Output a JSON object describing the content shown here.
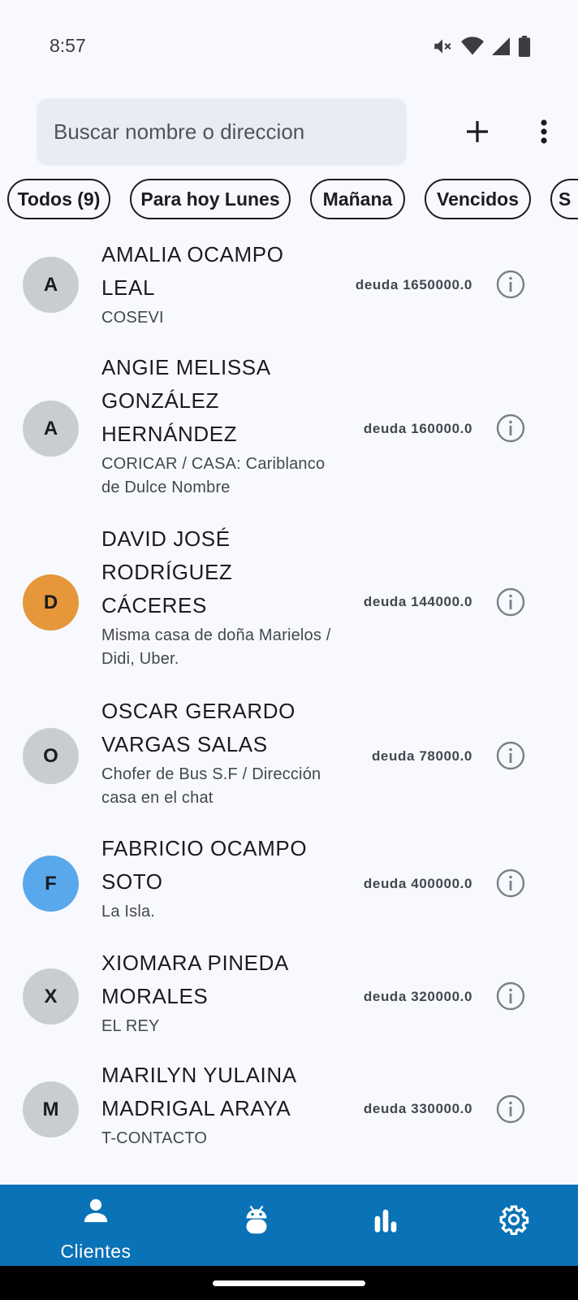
{
  "status_bar": {
    "time": "8:57"
  },
  "search": {
    "placeholder": "Buscar nombre o direccion"
  },
  "chips": [
    {
      "label": "Todos (9)"
    },
    {
      "label": "Para hoy Lunes"
    },
    {
      "label": "Mañana"
    },
    {
      "label": "Vencidos"
    },
    {
      "label": "S"
    }
  ],
  "clients": [
    {
      "initial": "A",
      "avatar_color": "#c9ccd1",
      "name": "AMALIA OCAMPO LEAL",
      "address": "COSEVI",
      "debt": "deuda 1650000.0"
    },
    {
      "initial": "A",
      "avatar_color": "#c9ccd1",
      "name": "ANGIE MELISSA GONZÁLEZ HERNÁNDEZ",
      "address": "CORICAR / CASA: Cariblanco de Dulce Nombre",
      "debt": "deuda 160000.0"
    },
    {
      "initial": "D",
      "avatar_color": "#e5973a",
      "name": "DAVID JOSÉ RODRÍGUEZ CÁCERES",
      "address": "Misma casa de doña Marielos / Didi, Uber.",
      "debt": "deuda 144000.0"
    },
    {
      "initial": "O",
      "avatar_color": "#c9ccd1",
      "name": "OSCAR GERARDO VARGAS SALAS",
      "address": "Chofer de Bus S.F / Dirección casa en el chat",
      "debt": "deuda 78000.0"
    },
    {
      "initial": "F",
      "avatar_color": "#5aa8ec",
      "name": "FABRICIO OCAMPO SOTO",
      "address": "La Isla.",
      "debt": "deuda 400000.0"
    },
    {
      "initial": "X",
      "avatar_color": "#c9ccd1",
      "name": "XIOMARA PINEDA MORALES",
      "address": "EL REY",
      "debt": "deuda 320000.0"
    },
    {
      "initial": "M",
      "avatar_color": "#c9ccd1",
      "name": "MARILYN YULAINA MADRIGAL ARAYA",
      "address": "T-CONTACTO",
      "debt": "deuda 330000.0"
    }
  ],
  "bottom_nav": {
    "items": [
      {
        "label": "Clientes",
        "icon": "person-icon",
        "selected": true
      },
      {
        "label": "",
        "icon": "android-icon",
        "selected": false
      },
      {
        "label": "",
        "icon": "bar-chart-icon",
        "selected": false
      },
      {
        "label": "",
        "icon": "settings-gear-icon",
        "selected": false
      }
    ]
  },
  "colors": {
    "nav_background": "#0a72b6",
    "page_background": "#f8f9ff",
    "search_background": "#e8edf5"
  }
}
